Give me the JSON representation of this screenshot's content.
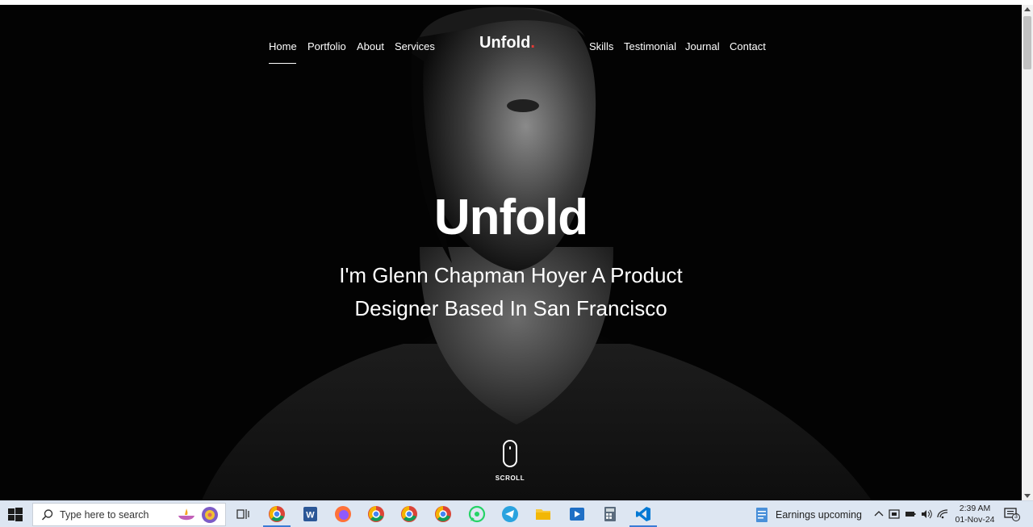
{
  "nav": {
    "left": [
      "Home",
      "Portfolio",
      "About",
      "Services"
    ],
    "brand": "Unfold",
    "brand_dot": ".",
    "right": [
      "Skills",
      "Testimonial",
      "Journal",
      "Contact"
    ],
    "active": "Home"
  },
  "hero": {
    "title": "Unfold",
    "subtitle_line1": "I'm Glenn Chapman Hoyer A Product",
    "subtitle_line2": "Designer Based In San Francisco",
    "scroll_label": "SCROLL"
  },
  "taskbar": {
    "search_placeholder": "Type here to search",
    "news_text": "Earnings upcoming",
    "time": "2:39 AM",
    "date": "01-Nov-24",
    "notification_count": "3",
    "pinned_apps": [
      "chrome-profile",
      "word",
      "firefox",
      "chrome",
      "chrome",
      "chrome",
      "whatsapp",
      "telegram",
      "file-explorer",
      "media-player",
      "calculator",
      "vs-code"
    ]
  },
  "colors": {
    "accent_dot": "#e53935",
    "taskbar": "#dde6f2",
    "hero_bg": "#030303"
  }
}
